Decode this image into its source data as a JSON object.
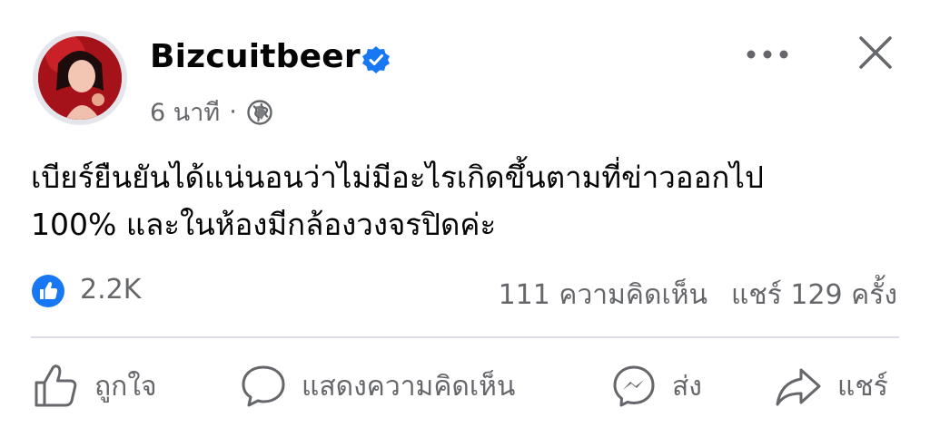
{
  "post": {
    "author": "Bizcuitbeer",
    "time": "6 นาที",
    "separator": "·",
    "text_line1": "เบียร์ยืนยันได้แน่นอนว่าไม่มีอะไรเกิดขึ้นตามที่ข่าวออกไป",
    "text_line2": "100% และในห้องมีกล้องวงจรปิดค่ะ"
  },
  "stats": {
    "likes": "2.2K",
    "comments": "111 ความคิดเห็น",
    "shares": "แชร์ 129 ครั้ง"
  },
  "actions": {
    "like": "ถูกใจ",
    "comment": "แสดงความคิดเห็น",
    "send": "ส่ง",
    "share": "แชร์"
  },
  "colors": {
    "brand_blue": "#1877f2",
    "secondary_text": "#65676b",
    "divider": "#dadde1"
  },
  "icons": [
    "verified-badge-icon",
    "globe-icon",
    "more-options-icon",
    "close-icon",
    "like-reaction-icon",
    "thumbs-up-icon",
    "comment-bubble-icon",
    "messenger-icon",
    "share-arrow-icon"
  ]
}
